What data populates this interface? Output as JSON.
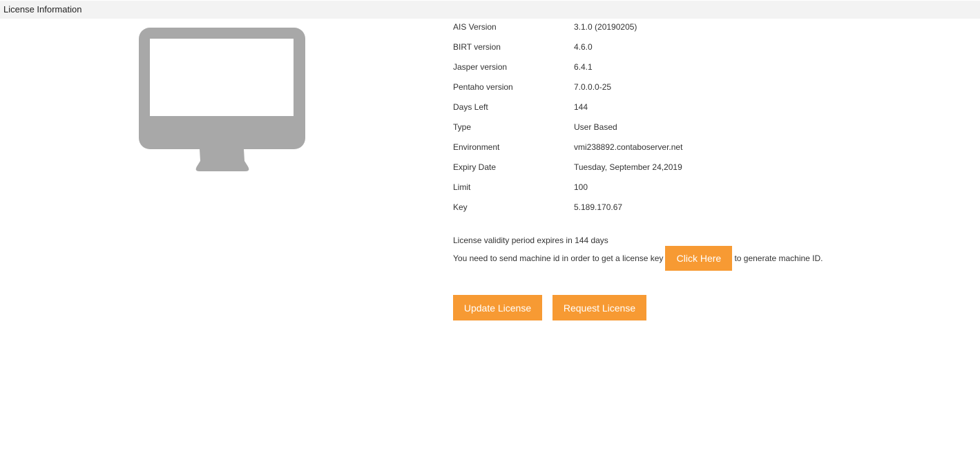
{
  "header": {
    "title": "License Information"
  },
  "monitor": {
    "icon": "monitor-icon",
    "color": "#a8a8a8"
  },
  "info": [
    {
      "label": "AIS Version",
      "value": "3.1.0 (20190205)"
    },
    {
      "label": "BIRT version",
      "value": "4.6.0"
    },
    {
      "label": "Jasper version",
      "value": "6.4.1"
    },
    {
      "label": "Pentaho version",
      "value": "7.0.0.0-25"
    },
    {
      "label": "Days Left",
      "value": "144"
    },
    {
      "label": "Type",
      "value": "User Based"
    },
    {
      "label": "Environment",
      "value": "vmi238892.contaboserver.net"
    },
    {
      "label": "Expiry Date",
      "value": "Tuesday, September 24,2019"
    },
    {
      "label": "Limit",
      "value": "100"
    },
    {
      "label": "Key",
      "value": "5.189.170.67"
    }
  ],
  "validity_text": "License validity period expires in 144 days",
  "machine": {
    "prefix": "You need to send machine id in order to get a license key",
    "button_label": "Click Here",
    "suffix": "to generate machine ID."
  },
  "actions": {
    "update_label": "Update License",
    "request_label": "Request License"
  },
  "colors": {
    "accent": "#f79a33",
    "header_bg": "#f3f3f3"
  }
}
